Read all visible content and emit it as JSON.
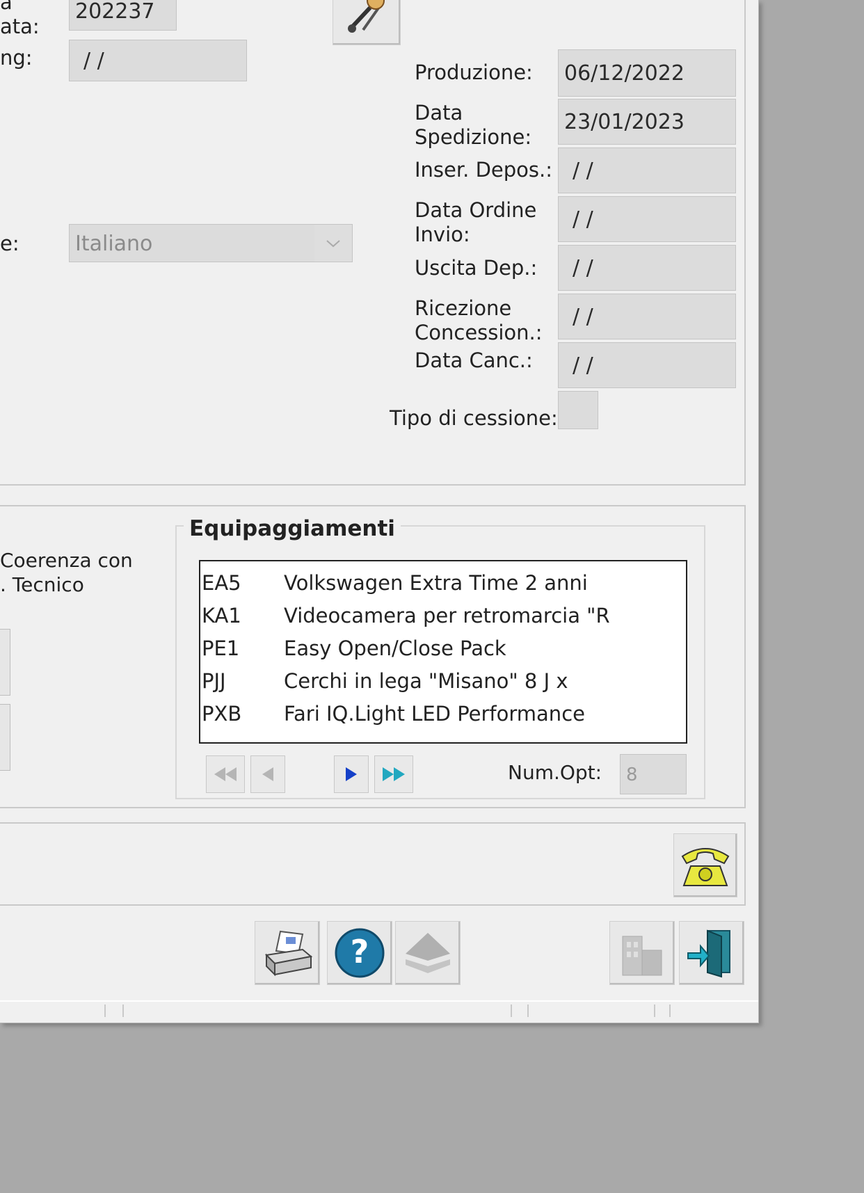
{
  "top_left": {
    "label_partial_1": "a\nata:",
    "field_1": "202237",
    "label_partial_2": "ng:",
    "field_2": " / /",
    "label_partial_3": "e:",
    "language_select": "Italiano"
  },
  "dates": [
    {
      "label": "Produzione:",
      "value": "06/12/2022"
    },
    {
      "label": "Data\nSpedizione:",
      "value": "23/01/2023"
    },
    {
      "label": "Inser. Depos.:",
      "value": " / /"
    },
    {
      "label": "Data Ordine\nInvio:",
      "value": " / /"
    },
    {
      "label": "Uscita Dep.:",
      "value": " / /"
    },
    {
      "label": "Ricezione\nConcession.:",
      "value": " / /"
    },
    {
      "label": "Data Canc.:",
      "value": " / /"
    }
  ],
  "tipo_cessione": {
    "label": "Tipo di cessione:",
    "value": ""
  },
  "left_partial": {
    "text": "Coerenza con\n. Tecnico"
  },
  "equipaggiamenti": {
    "title": "Equipaggiamenti",
    "items": [
      {
        "code": "EA5",
        "desc": "Volkswagen Extra Time 2 anni"
      },
      {
        "code": "KA1",
        "desc": "Videocamera per retromarcia \"R"
      },
      {
        "code": "PE1",
        "desc": "Easy Open/Close Pack"
      },
      {
        "code": "PJJ",
        "desc": "Cerchi in lega \"Misano\" 8 J x"
      },
      {
        "code": "PXB",
        "desc": "Fari IQ.Light LED Performance"
      }
    ],
    "num_opt_label": "Num.Opt:",
    "num_opt_value": "8"
  },
  "icons": {
    "tool": "tools-icon",
    "phone": "telephone-icon",
    "print": "printer-icon",
    "help": "help-icon",
    "layers": "layers-icon",
    "building": "building-icon",
    "exit": "exit-door-icon"
  }
}
